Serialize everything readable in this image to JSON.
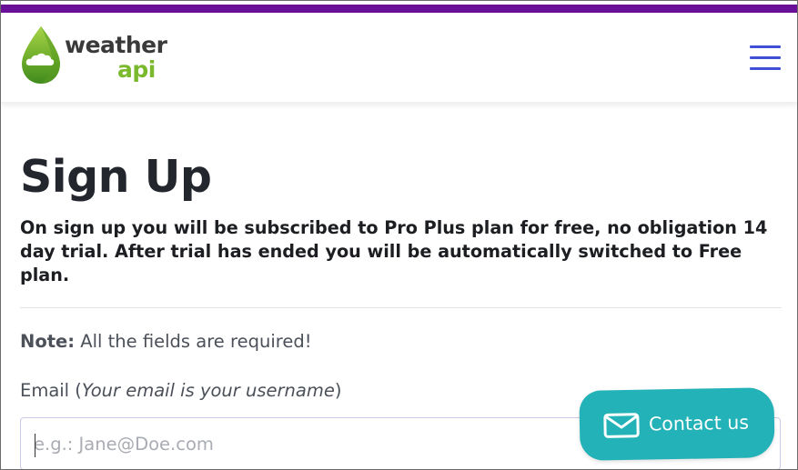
{
  "header": {
    "logo": {
      "word_main": "weather",
      "word_sub": "api",
      "icon": "leaf-drop-logo-icon"
    },
    "menu_icon": "hamburger-menu-icon"
  },
  "page": {
    "title": "Sign Up",
    "intro": "On sign up you will be subscribed to Pro Plus plan for free, no obligation 14 day trial. After trial has ended you will be automatically switched to Free plan.",
    "note_label": "Note:",
    "note_text": " All the fields are required!",
    "email_label": "Email (",
    "email_hint": "Your email is your username",
    "email_label_close": ")",
    "email_placeholder": "e.g.: Jane@Doe.com"
  },
  "contact": {
    "label": "Contact us",
    "icon": "envelope-icon"
  },
  "colors": {
    "top_stripe": "#6a0f97",
    "menu": "#3f4fd6",
    "contact_bg": "#23b2b7",
    "logo_green": "#7ab92b",
    "title": "#23262d"
  }
}
